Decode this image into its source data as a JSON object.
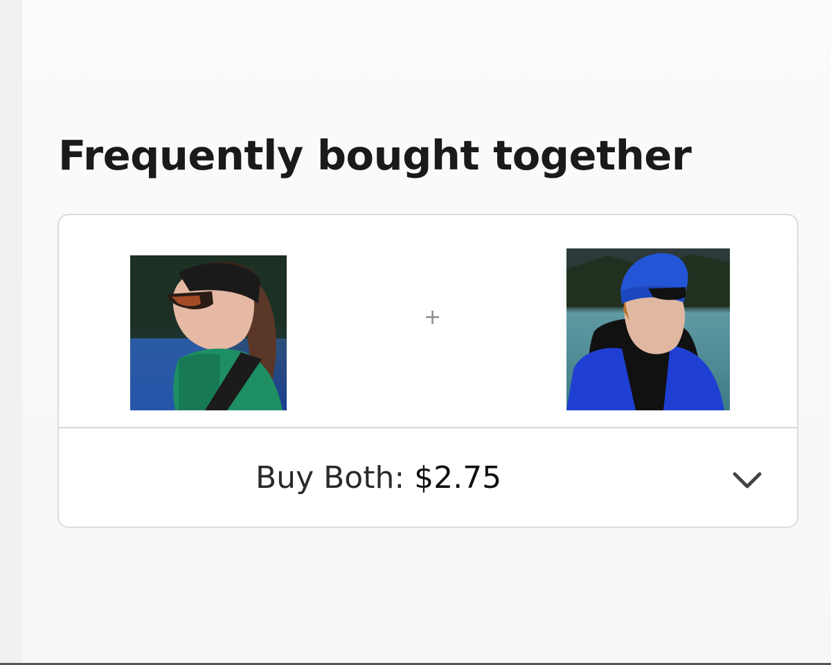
{
  "section": {
    "title": "Frequently bought together"
  },
  "products": [
    {
      "icon": "product-headband-photo"
    },
    {
      "icon": "product-beanie-photo"
    }
  ],
  "separator": {
    "symbol": "+"
  },
  "bundle": {
    "label": "Buy Both:",
    "price": "$2.75",
    "expand_icon": "chevron-down-icon"
  },
  "colors": {
    "title": "#1a1a1a",
    "border": "#dcdcdc",
    "plus": "#8c8c8c",
    "chevron": "#444444"
  }
}
